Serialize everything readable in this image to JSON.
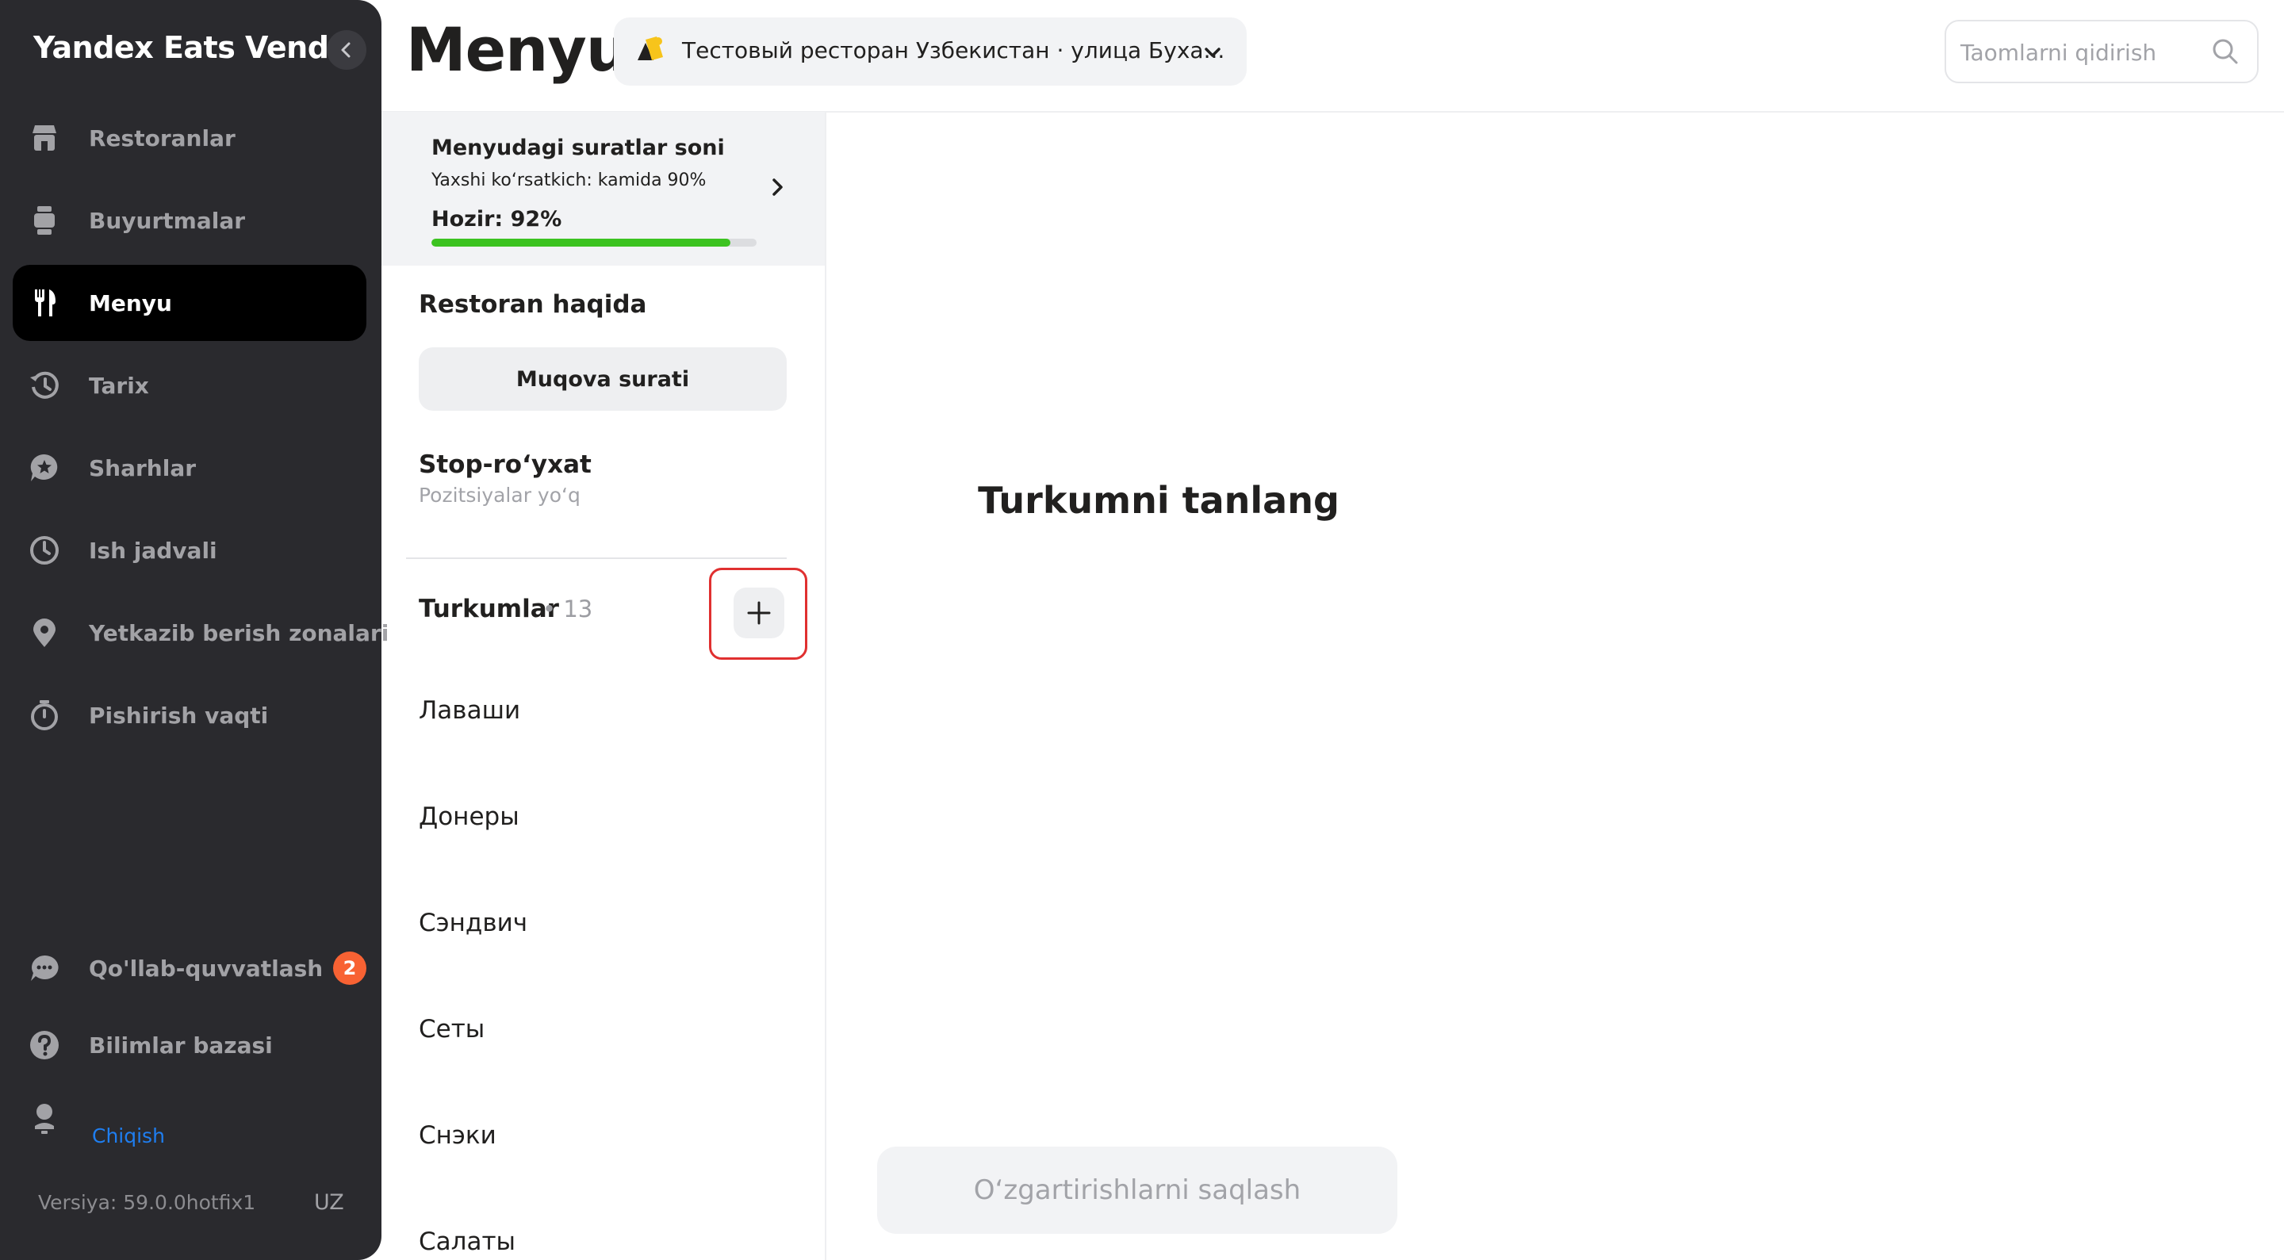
{
  "sidebar": {
    "brand": "Yandex Eats Vendor",
    "items": [
      {
        "label": "Restoranlar",
        "icon": "store-icon"
      },
      {
        "label": "Buyurtmalar",
        "icon": "orders-icon"
      },
      {
        "label": "Menyu",
        "icon": "fork-knife-icon",
        "active": true
      },
      {
        "label": "Tarix",
        "icon": "history-icon"
      },
      {
        "label": "Sharhlar",
        "icon": "reviews-icon"
      },
      {
        "label": "Ish jadvali",
        "icon": "clock-icon"
      },
      {
        "label": "Yetkazib berish zonalari",
        "icon": "location-pin-icon"
      },
      {
        "label": "Pishirish vaqti",
        "icon": "stopwatch-icon"
      }
    ],
    "support": {
      "label": "Qo'llab-quvvatlash",
      "badge": "2",
      "icon": "chat-icon"
    },
    "knowledge": {
      "label": "Bilimlar bazasi",
      "icon": "help-icon"
    },
    "logout": "Chiqish",
    "version": "Versiya: 59.0.0hotfix1",
    "language": "UZ"
  },
  "header": {
    "title": "Menyu",
    "restaurant": "Тестовый ресторан Узбекистан · улица Буха...",
    "search_placeholder": "Taomlarni qidirish"
  },
  "photo_card": {
    "title": "Menyudagi suratlar soni",
    "subtitle": "Yaxshi ko‘rsatkich: kamida 90%",
    "current": "Hozir: 92%",
    "progress": 0.92
  },
  "about": {
    "title": "Restoran haqida",
    "cover_button": "Muqova surati"
  },
  "stop_list": {
    "title": "Stop-ro‘yxat",
    "subtitle": "Pozitsiyalar yo‘q"
  },
  "categories": {
    "title": "Turkumlar",
    "count": "• 13",
    "items": [
      "Лаваши",
      "Донеры",
      "Сэндвич",
      "Сеты",
      "Снэки",
      "Салаты"
    ]
  },
  "main": {
    "placeholder": "Turkumni tanlang",
    "save_button": "O‘zgartirishlarni saqlash"
  },
  "colors": {
    "sidebar_bg": "#2a2a2e",
    "active_bg": "#000000",
    "progress_fill": "#3cc320",
    "badge": "#f86233",
    "highlight": "#e03030",
    "link": "#1f7ef0"
  }
}
